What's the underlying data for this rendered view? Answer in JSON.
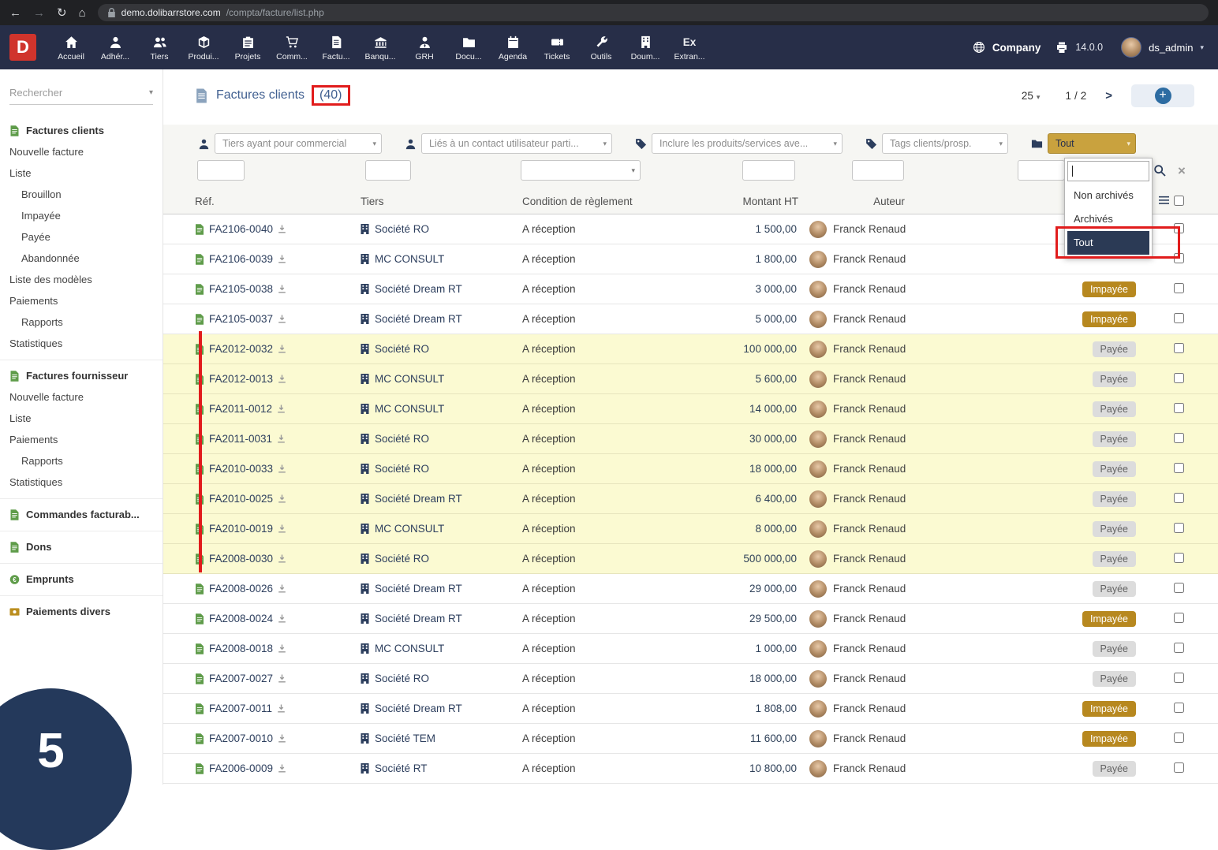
{
  "browser": {
    "url_host": "demo.dolibarrstore.com",
    "url_path": "/compta/facture/list.php"
  },
  "topnav": {
    "logo_letter": "D",
    "items": [
      {
        "label": "Accueil",
        "icon": "home"
      },
      {
        "label": "Adhér...",
        "icon": "member"
      },
      {
        "label": "Tiers",
        "icon": "tiers"
      },
      {
        "label": "Produi...",
        "icon": "products"
      },
      {
        "label": "Projets",
        "icon": "projects"
      },
      {
        "label": "Comm...",
        "icon": "commerce"
      },
      {
        "label": "Factu...",
        "icon": "invoice"
      },
      {
        "label": "Banqu...",
        "icon": "bank"
      },
      {
        "label": "GRH",
        "icon": "grh"
      },
      {
        "label": "Docu...",
        "icon": "docs"
      },
      {
        "label": "Agenda",
        "icon": "agenda"
      },
      {
        "label": "Tickets",
        "icon": "tickets"
      },
      {
        "label": "Outils",
        "icon": "tools"
      },
      {
        "label": "Doum...",
        "icon": "building"
      },
      {
        "label": "Extran...",
        "icon": "ex",
        "icon_text": "Ex"
      }
    ],
    "company_label": "Company",
    "version": "14.0.0",
    "username": "ds_admin"
  },
  "sidebar": {
    "search_placeholder": "Rechercher",
    "sections": [
      {
        "header": "Factures clients",
        "icon": "s_invoice",
        "items": [
          {
            "label": "Nouvelle facture",
            "indent": 0
          },
          {
            "label": "Liste",
            "indent": 0
          },
          {
            "label": "Brouillon",
            "indent": 1
          },
          {
            "label": "Impayée",
            "indent": 1
          },
          {
            "label": "Payée",
            "indent": 1
          },
          {
            "label": "Abandonnée",
            "indent": 1
          },
          {
            "label": "Liste des modèles",
            "indent": 0
          },
          {
            "label": "Paiements",
            "indent": 0
          },
          {
            "label": "Rapports",
            "indent": 1
          },
          {
            "label": "Statistiques",
            "indent": 0
          }
        ]
      },
      {
        "header": "Factures fournisseur",
        "icon": "s_invoice",
        "items": [
          {
            "label": "Nouvelle facture",
            "indent": 0
          },
          {
            "label": "Liste",
            "indent": 0
          },
          {
            "label": "Paiements",
            "indent": 0
          },
          {
            "label": "Rapports",
            "indent": 1
          },
          {
            "label": "Statistiques",
            "indent": 0
          }
        ]
      },
      {
        "header": "Commandes facturab...",
        "icon": "s_invoice",
        "items": []
      },
      {
        "header": "Dons",
        "icon": "s_invoice",
        "items": []
      },
      {
        "header": "Emprunts",
        "icon": "s_loan",
        "items": []
      },
      {
        "header": "Paiements divers",
        "icon": "s_payment",
        "items": []
      }
    ],
    "step_badge": "5"
  },
  "main": {
    "title": "Factures clients",
    "title_count": "(40)",
    "pagination": {
      "page_size": "25",
      "current_page": "1",
      "separator": "/",
      "total_pages": "2"
    },
    "filters": [
      {
        "icon": "user",
        "label": "Tiers ayant pour commercial"
      },
      {
        "icon": "user",
        "label": "Liés à un contact utilisateur parti..."
      },
      {
        "icon": "tag",
        "label": "Inclure les produits/services ave..."
      },
      {
        "icon": "tag",
        "label": "Tags clients/prosp."
      },
      {
        "icon": "folder",
        "label": "Tout",
        "active": true
      }
    ],
    "status_dropdown": {
      "options": [
        "Non archivés",
        "Archivés",
        "Tout"
      ],
      "selected": "Tout"
    },
    "table": {
      "columns": [
        "Réf.",
        "Tiers",
        "Condition de règlement",
        "Montant HT",
        "Auteur"
      ],
      "rows": [
        {
          "ref": "FA2106-0040",
          "tiers": "Société RO",
          "condition": "A réception",
          "montant": "1 500,00",
          "auteur": "Franck Renaud",
          "status": "",
          "highlight": false
        },
        {
          "ref": "FA2106-0039",
          "tiers": "MC CONSULT",
          "condition": "A réception",
          "montant": "1 800,00",
          "auteur": "Franck Renaud",
          "status": "",
          "highlight": false
        },
        {
          "ref": "FA2105-0038",
          "tiers": "Société Dream RT",
          "condition": "A réception",
          "montant": "3 000,00",
          "auteur": "Franck Renaud",
          "status": "Impayée",
          "highlight": false
        },
        {
          "ref": "FA2105-0037",
          "tiers": "Société Dream RT",
          "condition": "A réception",
          "montant": "5 000,00",
          "auteur": "Franck Renaud",
          "status": "Impayée",
          "highlight": false
        },
        {
          "ref": "FA2012-0032",
          "tiers": "Société RO",
          "condition": "A réception",
          "montant": "100 000,00",
          "auteur": "Franck Renaud",
          "status": "Payée",
          "highlight": true
        },
        {
          "ref": "FA2012-0013",
          "tiers": "MC CONSULT",
          "condition": "A réception",
          "montant": "5 600,00",
          "auteur": "Franck Renaud",
          "status": "Payée",
          "highlight": true
        },
        {
          "ref": "FA2011-0012",
          "tiers": "MC CONSULT",
          "condition": "A réception",
          "montant": "14 000,00",
          "auteur": "Franck Renaud",
          "status": "Payée",
          "highlight": true
        },
        {
          "ref": "FA2011-0031",
          "tiers": "Société RO",
          "condition": "A réception",
          "montant": "30 000,00",
          "auteur": "Franck Renaud",
          "status": "Payée",
          "highlight": true
        },
        {
          "ref": "FA2010-0033",
          "tiers": "Société RO",
          "condition": "A réception",
          "montant": "18 000,00",
          "auteur": "Franck Renaud",
          "status": "Payée",
          "highlight": true
        },
        {
          "ref": "FA2010-0025",
          "tiers": "Société Dream RT",
          "condition": "A réception",
          "montant": "6 400,00",
          "auteur": "Franck Renaud",
          "status": "Payée",
          "highlight": true
        },
        {
          "ref": "FA2010-0019",
          "tiers": "MC CONSULT",
          "condition": "A réception",
          "montant": "8 000,00",
          "auteur": "Franck Renaud",
          "status": "Payée",
          "highlight": true
        },
        {
          "ref": "FA2008-0030",
          "tiers": "Société RO",
          "condition": "A réception",
          "montant": "500 000,00",
          "auteur": "Franck Renaud",
          "status": "Payée",
          "highlight": true
        },
        {
          "ref": "FA2008-0026",
          "tiers": "Société Dream RT",
          "condition": "A réception",
          "montant": "29 000,00",
          "auteur": "Franck Renaud",
          "status": "Payée",
          "highlight": false
        },
        {
          "ref": "FA2008-0024",
          "tiers": "Société Dream RT",
          "condition": "A réception",
          "montant": "29 500,00",
          "auteur": "Franck Renaud",
          "status": "Impayée",
          "highlight": false
        },
        {
          "ref": "FA2008-0018",
          "tiers": "MC CONSULT",
          "condition": "A réception",
          "montant": "1 000,00",
          "auteur": "Franck Renaud",
          "status": "Payée",
          "highlight": false
        },
        {
          "ref": "FA2007-0027",
          "tiers": "Société RO",
          "condition": "A réception",
          "montant": "18 000,00",
          "auteur": "Franck Renaud",
          "status": "Payée",
          "highlight": false
        },
        {
          "ref": "FA2007-0011",
          "tiers": "Société Dream RT",
          "condition": "A réception",
          "montant": "1 808,00",
          "auteur": "Franck Renaud",
          "status": "Impayée",
          "highlight": false
        },
        {
          "ref": "FA2007-0010",
          "tiers": "Société TEM",
          "condition": "A réception",
          "montant": "11 600,00",
          "auteur": "Franck Renaud",
          "status": "Impayée",
          "highlight": false
        },
        {
          "ref": "FA2006-0009",
          "tiers": "Société RT",
          "condition": "A réception",
          "montant": "10 800,00",
          "auteur": "Franck Renaud",
          "status": "Payée",
          "highlight": false
        }
      ]
    }
  }
}
